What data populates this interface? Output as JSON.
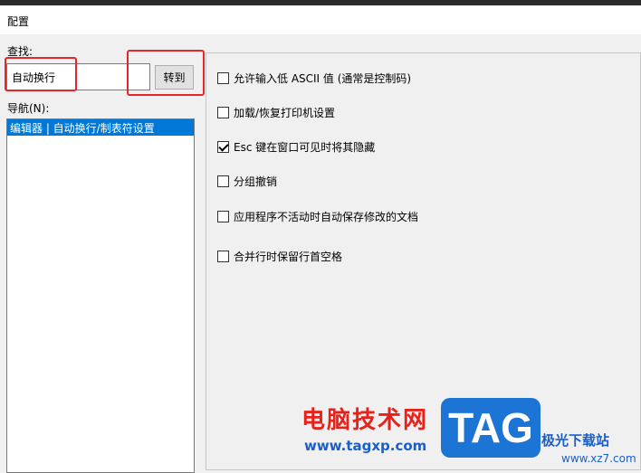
{
  "window": {
    "title": "配置"
  },
  "search": {
    "label": "查找:",
    "value": "自动换行",
    "goto_label": "转到"
  },
  "nav": {
    "label": "导航(N):",
    "items": [
      {
        "label": "编辑器 | 自动换行/制表符设置",
        "selected": true
      }
    ]
  },
  "options": [
    {
      "label": "允许输入低 ASCII 值 (通常是控制码)",
      "checked": false
    },
    {
      "label": "加载/恢复打印机设置",
      "checked": false
    },
    {
      "label": "Esc 键在窗口可见时将其隐藏",
      "checked": true
    },
    {
      "label": "分组撤销",
      "checked": false
    },
    {
      "label": "应用程序不活动时自动保存修改的文档",
      "checked": false
    },
    {
      "label": "合并行时保留行首空格",
      "checked": false
    }
  ],
  "watermark": {
    "site_name": "电脑技术网",
    "site_url": "www.tagxp.com",
    "logo_text": "TAG",
    "brand": "极光下载站",
    "brand_url": "www.xz7.com"
  },
  "colors": {
    "selection": "#0078d7",
    "highlight": "#e5262b",
    "watermark_red": "#e8221b",
    "watermark_blue": "#1c74d4"
  }
}
